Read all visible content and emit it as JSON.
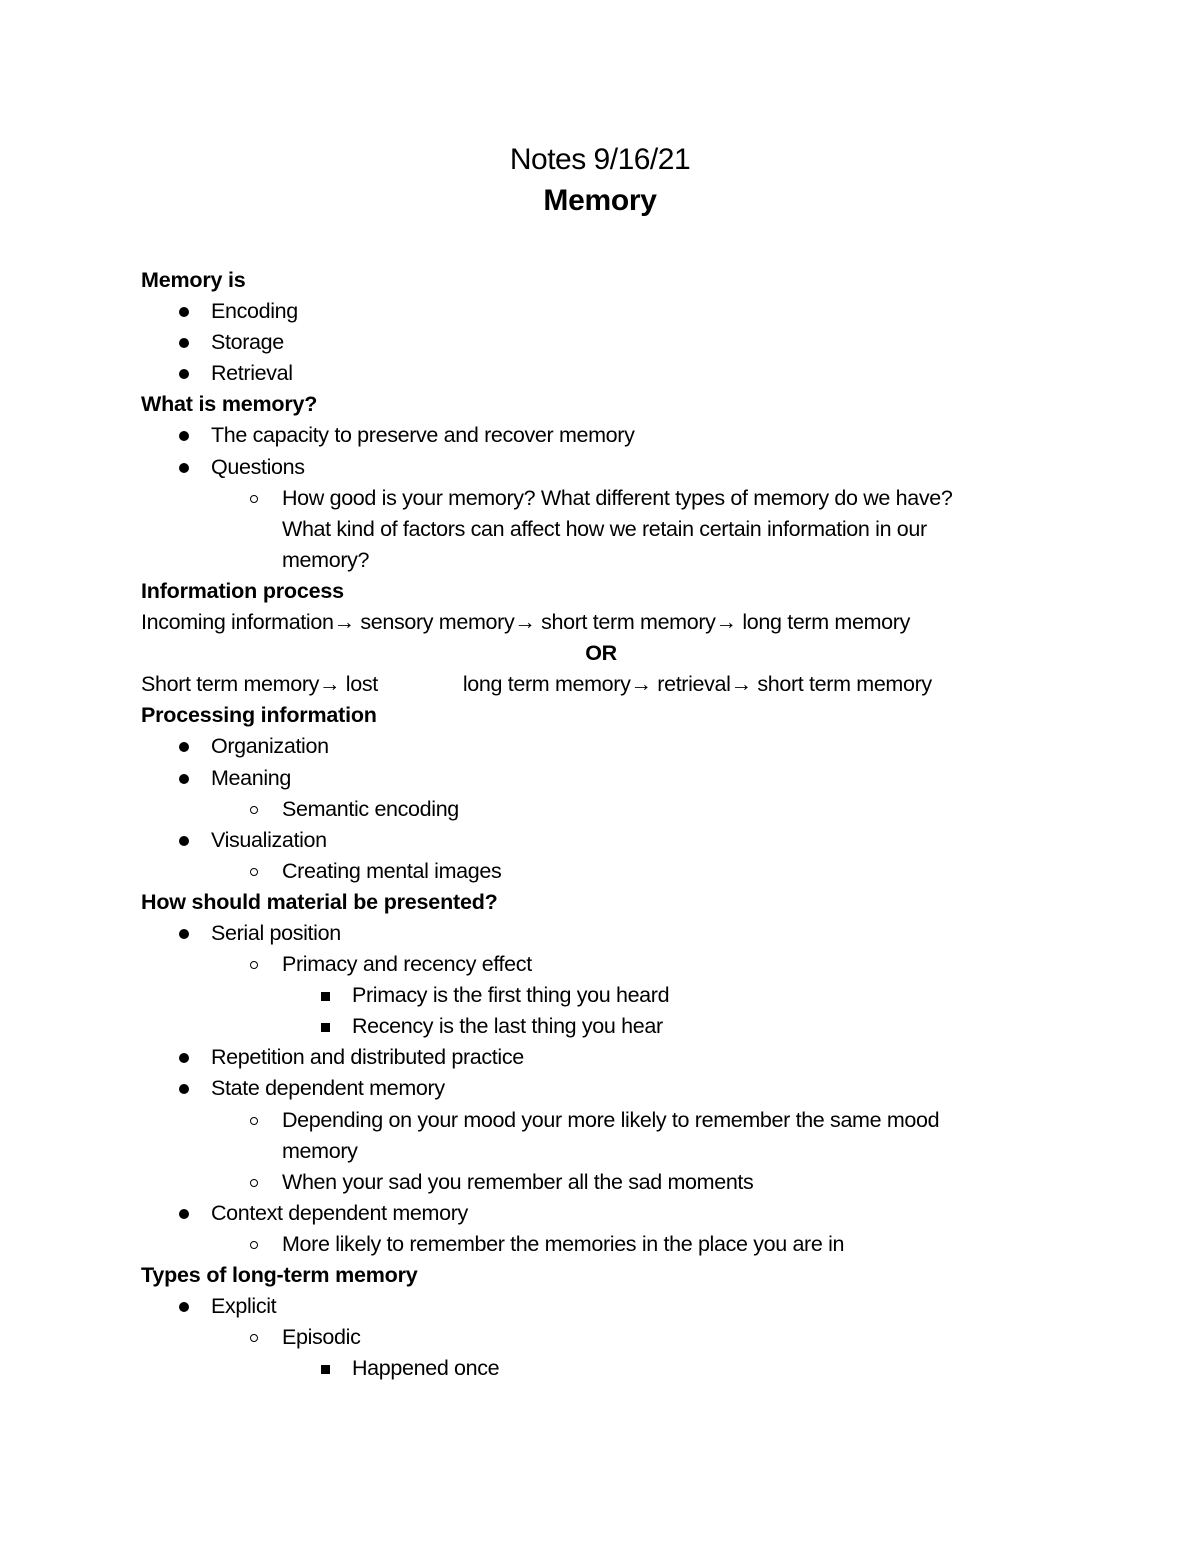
{
  "header": {
    "title": "Notes 9/16/21",
    "subtitle": "Memory"
  },
  "sections": {
    "memory_is": {
      "heading": "Memory is",
      "items": [
        "Encoding",
        "Storage",
        "Retrieval"
      ]
    },
    "what_is_memory": {
      "heading": "What is memory?",
      "item1": "The capacity to preserve and recover memory",
      "item2": "Questions",
      "sub1_line1": "How good is your memory? What different types of memory do we have?",
      "sub1_line2": "What kind of factors can affect how we retain certain information in our",
      "sub1_line3": "memory?"
    },
    "information_process": {
      "heading": "Information process",
      "flow1": "Incoming information→ sensory memory→ short term memory→ long term memory",
      "or": "OR",
      "flow2a": "Short term memory→ lost",
      "flow2b": "long term memory→ retrieval→ short term memory"
    },
    "processing_information": {
      "heading": "Processing information",
      "item1": "Organization",
      "item2": "Meaning",
      "item2_sub": "Semantic encoding",
      "item3": "Visualization",
      "item3_sub": "Creating mental images"
    },
    "presentation": {
      "heading": "How should material be presented?",
      "item1": "Serial position",
      "item1_sub": "Primacy and recency effect",
      "item1_sub_sub1": "Primacy is the first thing you heard",
      "item1_sub_sub2": "Recency is the last thing you hear",
      "item2": "Repetition and distributed practice",
      "item3": "State dependent memory",
      "item3_sub1_line1": "Depending on your mood your more likely to remember the same mood",
      "item3_sub1_line2": "memory",
      "item3_sub2": "When your sad you remember all the sad moments",
      "item4": "Context dependent memory",
      "item4_sub": "More likely to remember the memories in the place you are in"
    },
    "long_term_types": {
      "heading": "Types of long-term memory",
      "item1": "Explicit",
      "item1_sub": "Episodic",
      "item1_sub_sub": "Happened once"
    }
  }
}
